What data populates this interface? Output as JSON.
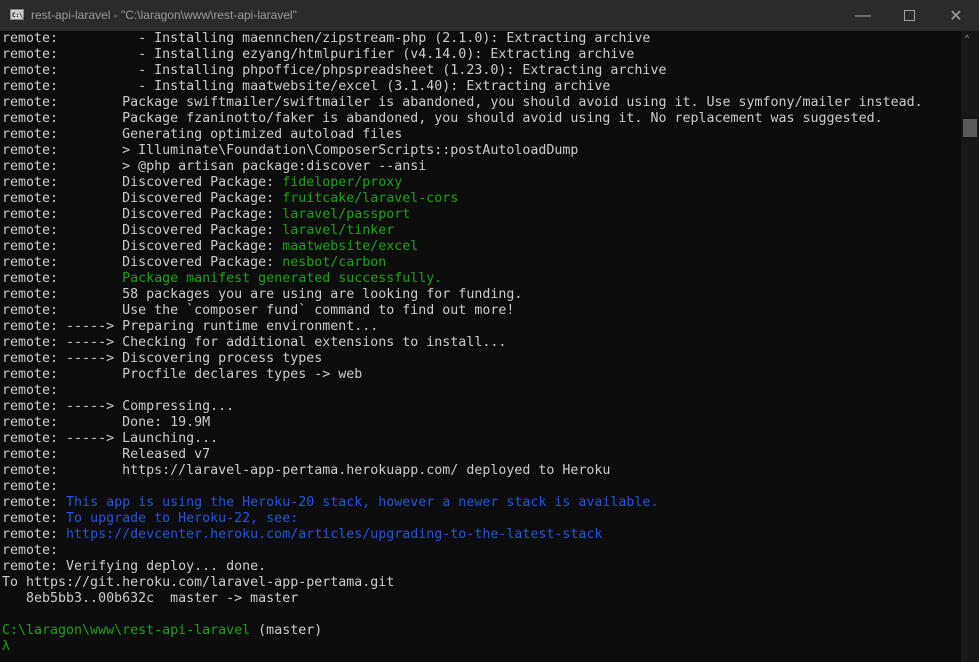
{
  "window": {
    "title": "rest-api-laravel - \"C:\\laragon\\www\\rest-api-laravel\"",
    "icon": "cmd-icon",
    "icon_text": "C:\\_"
  },
  "lines": [
    [
      [
        "remote:          - Installing maennchen/zipstream-php (2.1.0): Extracting archive",
        ""
      ]
    ],
    [
      [
        "remote:          - Installing ezyang/htmlpurifier (v4.14.0): Extracting archive",
        ""
      ]
    ],
    [
      [
        "remote:          - Installing phpoffice/phpspreadsheet (1.23.0): Extracting archive",
        ""
      ]
    ],
    [
      [
        "remote:          - Installing maatwebsite/excel (3.1.40): Extracting archive",
        ""
      ]
    ],
    [
      [
        "remote:        Package swiftmailer/swiftmailer is abandoned, you should avoid using it. Use symfony/mailer instead.",
        ""
      ]
    ],
    [
      [
        "remote:        Package fzaninotto/faker is abandoned, you should avoid using it. No replacement was suggested.",
        ""
      ]
    ],
    [
      [
        "remote:        Generating optimized autoload files",
        ""
      ]
    ],
    [
      [
        "remote:        > Illuminate\\Foundation\\ComposerScripts::postAutoloadDump",
        ""
      ]
    ],
    [
      [
        "remote:        > @php artisan package:discover --ansi",
        ""
      ]
    ],
    [
      [
        "remote:        Discovered Package: ",
        ""
      ],
      [
        "fideloper/proxy",
        "g"
      ]
    ],
    [
      [
        "remote:        Discovered Package: ",
        ""
      ],
      [
        "fruitcake/laravel-cors",
        "g"
      ]
    ],
    [
      [
        "remote:        Discovered Package: ",
        ""
      ],
      [
        "laravel/passport",
        "g"
      ]
    ],
    [
      [
        "remote:        Discovered Package: ",
        ""
      ],
      [
        "laravel/tinker",
        "g"
      ]
    ],
    [
      [
        "remote:        Discovered Package: ",
        ""
      ],
      [
        "maatwebsite/excel",
        "g"
      ]
    ],
    [
      [
        "remote:        Discovered Package: ",
        ""
      ],
      [
        "nesbot/carbon",
        "g"
      ]
    ],
    [
      [
        "remote:        ",
        ""
      ],
      [
        "Package manifest generated successfully.",
        "g"
      ]
    ],
    [
      [
        "remote:        58 packages you are using are looking for funding.",
        ""
      ]
    ],
    [
      [
        "remote:        Use the `composer fund` command to find out more!",
        ""
      ]
    ],
    [
      [
        "remote: -----> Preparing runtime environment...",
        ""
      ]
    ],
    [
      [
        "remote: -----> Checking for additional extensions to install...",
        ""
      ]
    ],
    [
      [
        "remote: -----> Discovering process types",
        ""
      ]
    ],
    [
      [
        "remote:        Procfile declares types -> web",
        ""
      ]
    ],
    [
      [
        "remote:",
        ""
      ]
    ],
    [
      [
        "remote: -----> Compressing...",
        ""
      ]
    ],
    [
      [
        "remote:        Done: 19.9M",
        ""
      ]
    ],
    [
      [
        "remote: -----> Launching...",
        ""
      ]
    ],
    [
      [
        "remote:        Released v7",
        ""
      ]
    ],
    [
      [
        "remote:        https://laravel-app-pertama.herokuapp.com/ deployed to Heroku",
        ""
      ]
    ],
    [
      [
        "remote:",
        ""
      ]
    ],
    [
      [
        "remote: ",
        ""
      ],
      [
        "This app is using the Heroku-20 stack, however a newer stack is available.",
        "b"
      ]
    ],
    [
      [
        "remote: ",
        ""
      ],
      [
        "To upgrade to Heroku-22, see:",
        "b"
      ]
    ],
    [
      [
        "remote: ",
        ""
      ],
      [
        "https://devcenter.heroku.com/articles/upgrading-to-the-latest-stack",
        "b"
      ]
    ],
    [
      [
        "remote:",
        ""
      ]
    ],
    [
      [
        "remote: Verifying deploy... done.",
        ""
      ]
    ],
    [
      [
        "To https://git.heroku.com/laravel-app-pertama.git",
        ""
      ]
    ],
    [
      [
        "   8eb5bb3..00b632c  master -> master",
        ""
      ]
    ],
    [
      [
        "",
        ""
      ]
    ],
    [
      [
        "C:\\laragon\\www\\rest-api-laravel",
        "g"
      ],
      [
        " (master)",
        ""
      ]
    ],
    [
      [
        "λ",
        "g"
      ]
    ]
  ],
  "colors": {
    "green": "#16a50e",
    "blue": "#2255e0",
    "text": "#cccccc",
    "background": "#0c0c0c"
  }
}
